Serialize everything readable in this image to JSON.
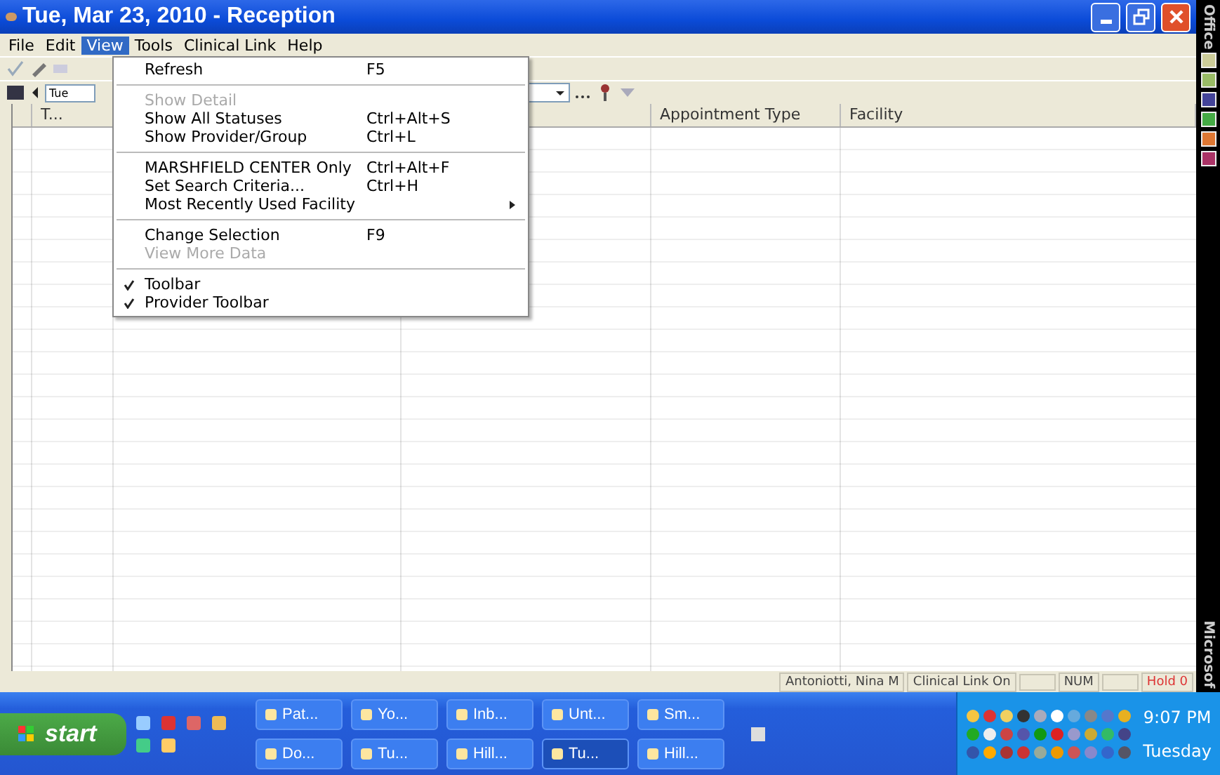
{
  "window": {
    "title": "Tue, Mar 23, 2010 - Reception"
  },
  "menu_bar": [
    {
      "label": "File",
      "selected": false
    },
    {
      "label": "Edit",
      "selected": false
    },
    {
      "label": "View",
      "selected": true
    },
    {
      "label": "Tools",
      "selected": false
    },
    {
      "label": "Clinical Link",
      "selected": false
    },
    {
      "label": "Help",
      "selected": false
    }
  ],
  "date_field": {
    "value": "Tue"
  },
  "table": {
    "columns": [
      "T...",
      "Appointment Type",
      "Facility"
    ]
  },
  "view_menu": [
    {
      "kind": "item",
      "label": "Refresh",
      "shortcut": "F5",
      "disabled": false,
      "checked": false
    },
    {
      "kind": "separator"
    },
    {
      "kind": "item",
      "label": "Show Detail",
      "disabled": true,
      "checked": false
    },
    {
      "kind": "item",
      "label": "Show All Statuses",
      "shortcut": "Ctrl+Alt+S",
      "disabled": false,
      "checked": false
    },
    {
      "kind": "item",
      "label": "Show Provider/Group",
      "shortcut": "Ctrl+L",
      "disabled": false,
      "checked": false
    },
    {
      "kind": "separator"
    },
    {
      "kind": "item",
      "label": "MARSHFIELD CENTER Only",
      "shortcut": "Ctrl+Alt+F",
      "disabled": false,
      "checked": false
    },
    {
      "kind": "item",
      "label": "Set Search Criteria...",
      "shortcut": "Ctrl+H",
      "disabled": false,
      "checked": false
    },
    {
      "kind": "submenu",
      "label": "Most Recently Used Facility",
      "disabled": false,
      "checked": false
    },
    {
      "kind": "separator"
    },
    {
      "kind": "item",
      "label": "Change Selection",
      "shortcut": "F9",
      "disabled": false,
      "checked": false
    },
    {
      "kind": "item",
      "label": "View More Data",
      "disabled": true,
      "checked": false
    },
    {
      "kind": "separator"
    },
    {
      "kind": "item",
      "label": "Toolbar",
      "disabled": false,
      "checked": true
    },
    {
      "kind": "item",
      "label": "Provider Toolbar",
      "disabled": false,
      "checked": true
    }
  ],
  "status_bar": [
    {
      "text": "Antoniotti, Nina M",
      "kind": "normal"
    },
    {
      "text": "Clinical Link On",
      "kind": "normal"
    },
    {
      "kind": "blank"
    },
    {
      "text": "NUM",
      "kind": "normal"
    },
    {
      "kind": "blank"
    },
    {
      "text": "Hold 0",
      "kind": "alert"
    }
  ],
  "side_bar": {
    "top_label": "Office",
    "bottom_label": "Microsof"
  },
  "taskbar": {
    "start": "start",
    "buttons": [
      {
        "label": "Pat...",
        "selected": false
      },
      {
        "label": "Yo...",
        "selected": false
      },
      {
        "label": "Inb...",
        "selected": false
      },
      {
        "label": "Unt...",
        "selected": false
      },
      {
        "label": "Sm...",
        "selected": false
      },
      {
        "label": "Do...",
        "selected": false
      },
      {
        "label": "Tu...",
        "selected": false
      },
      {
        "label": "Hill...",
        "selected": false
      },
      {
        "label": "Tu...",
        "selected": true
      },
      {
        "label": "Hill...",
        "selected": false
      }
    ],
    "clock": "9:07 PM",
    "day": "Tuesday"
  }
}
